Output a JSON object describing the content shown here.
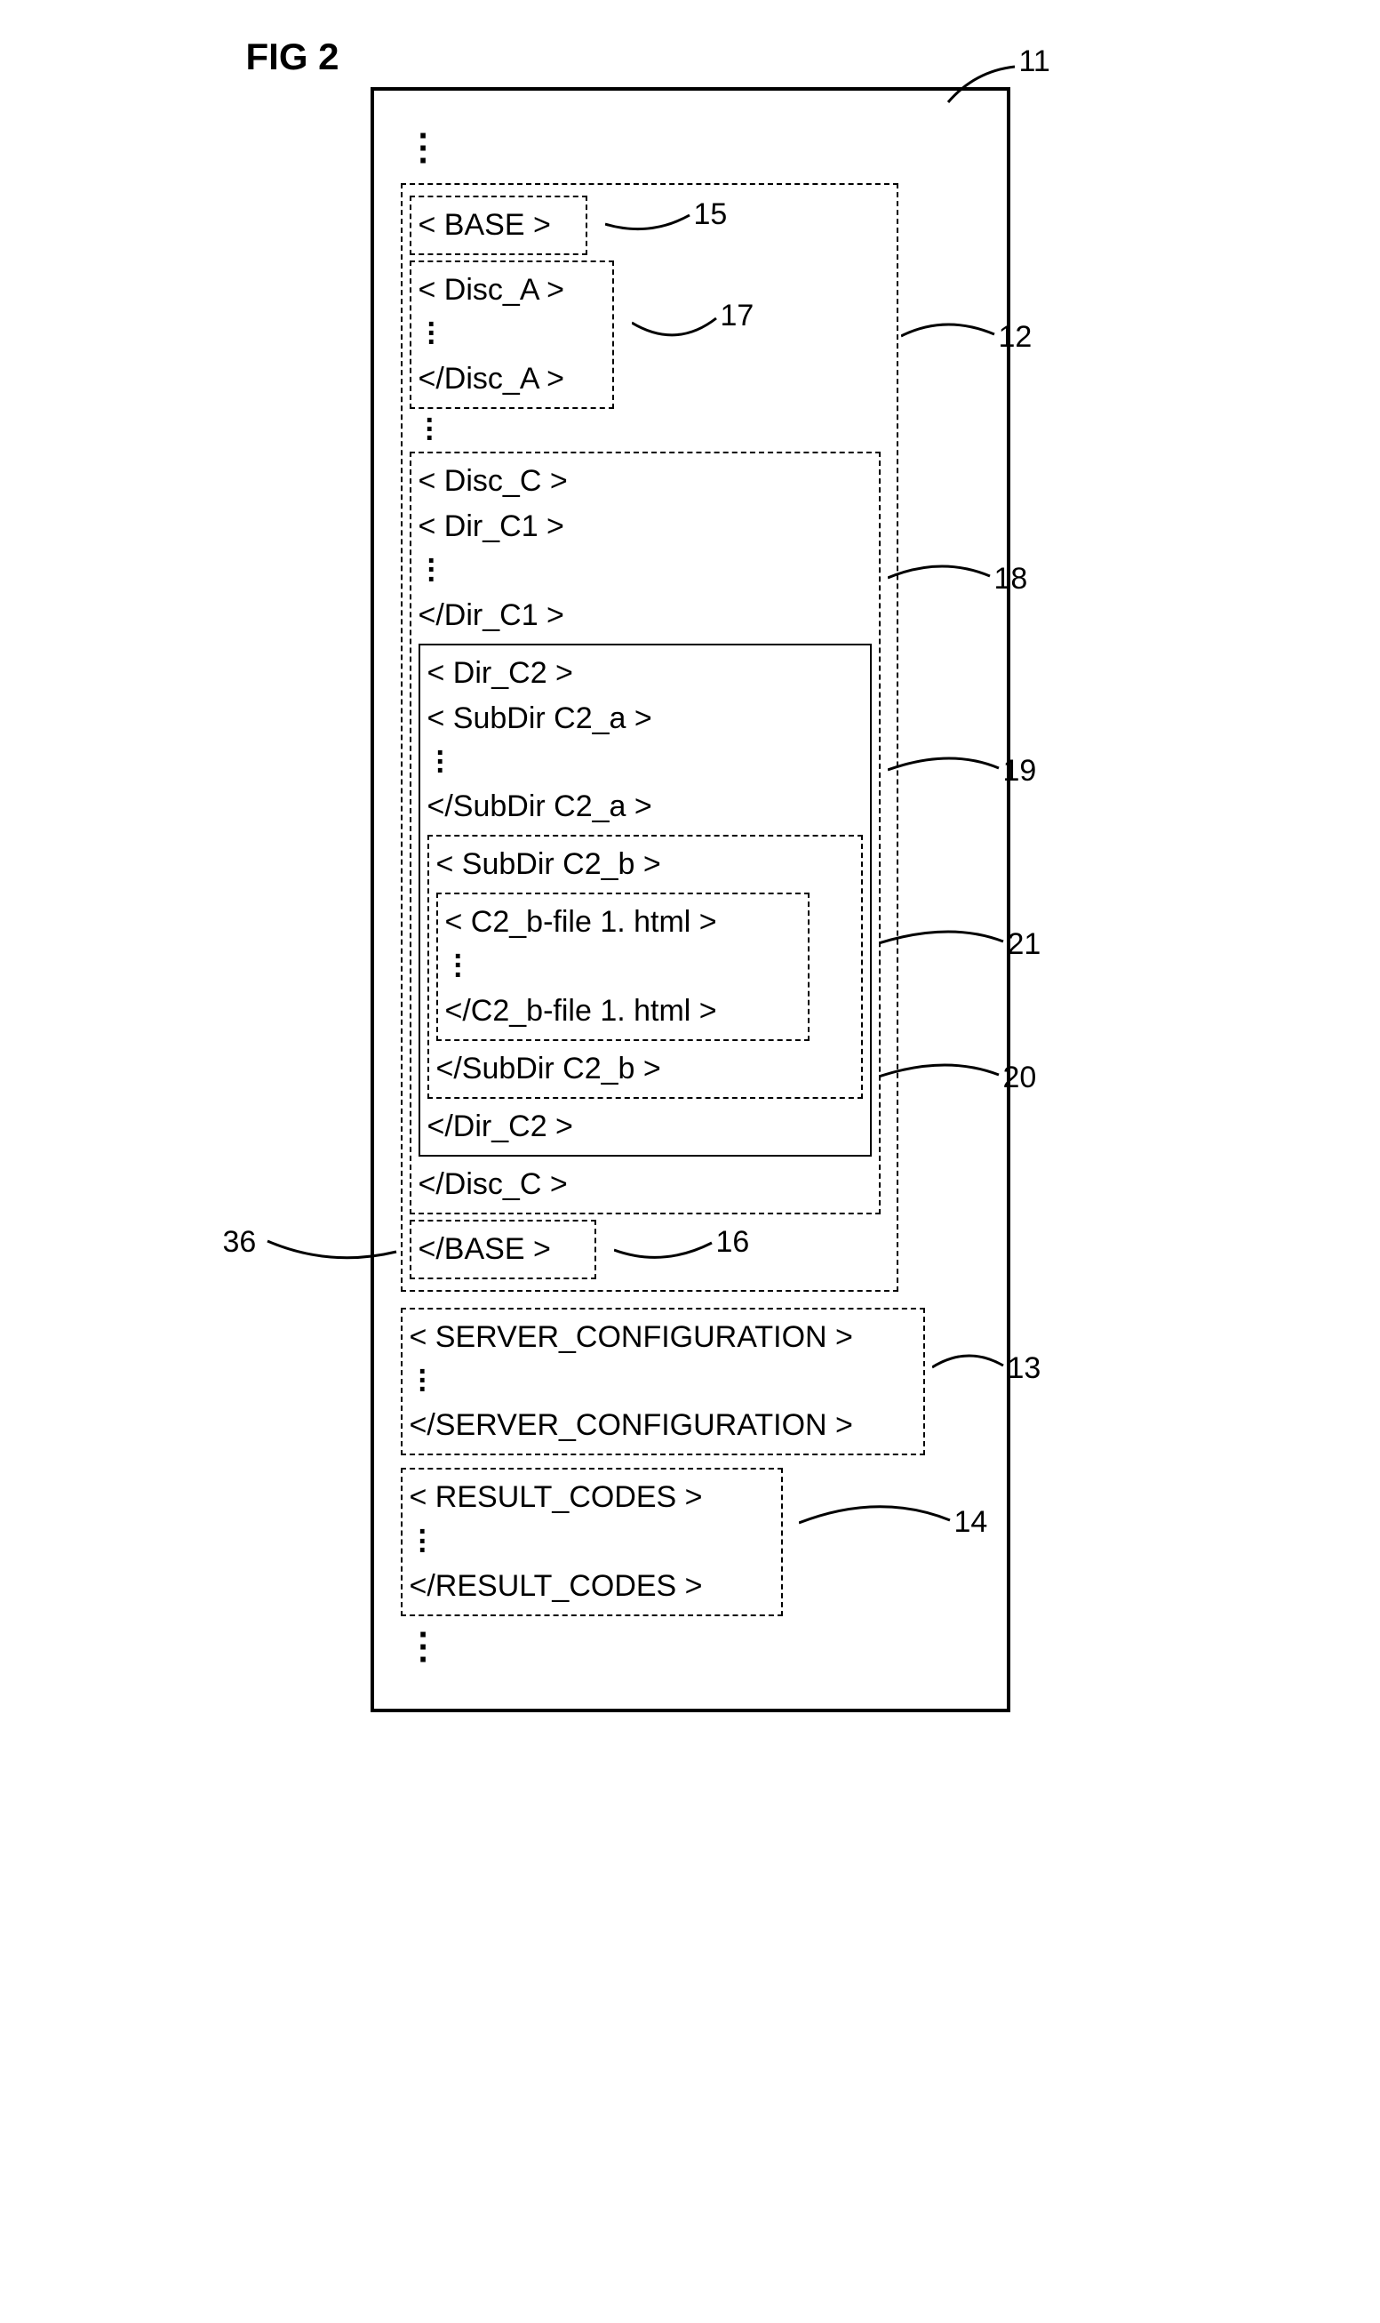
{
  "figure_label": "FIG 2",
  "callouts": {
    "n11": "11",
    "n12": "12",
    "n13": "13",
    "n14": "14",
    "n15": "15",
    "n16": "16",
    "n17": "17",
    "n18": "18",
    "n19": "19",
    "n20": "20",
    "n21": "21",
    "n36": "36"
  },
  "text": {
    "base_open": "< BASE >",
    "base_close": "</BASE >",
    "disc_a_open": "< Disc_A >",
    "disc_a_close": "</Disc_A >",
    "disc_c_open": "< Disc_C >",
    "disc_c_close": "</Disc_C >",
    "dir_c1_open": "< Dir_C1 >",
    "dir_c1_close": "</Dir_C1 >",
    "dir_c2_open": "< Dir_C2 >",
    "dir_c2_close": "</Dir_C2 >",
    "subdir_c2a_open": "< SubDir C2_a >",
    "subdir_c2a_close": "</SubDir C2_a >",
    "subdir_c2b_open": "< SubDir C2_b >",
    "subdir_c2b_close": "</SubDir C2_b >",
    "file_open": "< C2_b-file 1. html >",
    "file_close": "</C2_b-file 1. html >",
    "server_open": "< SERVER_CONFIGURATION >",
    "server_close": "</SERVER_CONFIGURATION >",
    "result_open": "< RESULT_CODES >",
    "result_close": "</RESULT_CODES >"
  }
}
